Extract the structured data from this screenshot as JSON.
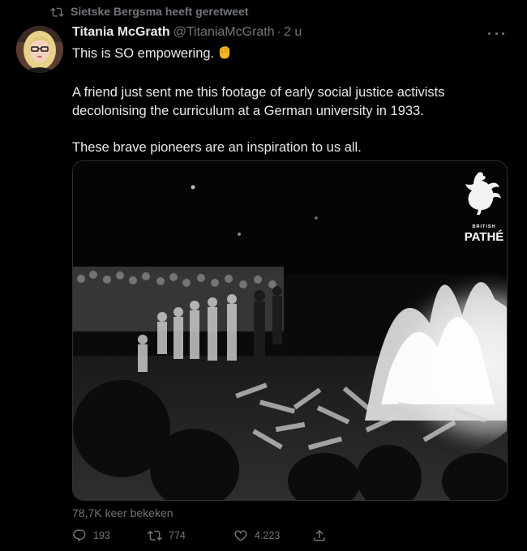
{
  "retweet": {
    "label": "Sietske Bergsma heeft geretweet"
  },
  "author": {
    "name": "Titania McGrath",
    "handle": "@TitaniaMcGrath",
    "separator": "·",
    "time": "2 u"
  },
  "tweet": {
    "line1": "This is SO empowering.",
    "line2": "A friend just sent me this footage of early social justice activists decolonising the curriculum at a German university in 1933.",
    "line3": "These brave pioneers are an inspiration to us all."
  },
  "media": {
    "watermark_small": "BRITISH",
    "watermark_brand": "PATHÉ"
  },
  "stats": {
    "views": "78,7K keer bekeken"
  },
  "actions": {
    "replies": "193",
    "retweets": "774",
    "likes": "4.223"
  },
  "icons": {
    "retweet_header": "retweet-icon",
    "more": "more-horizontal-icon",
    "fist": "raised-fist-emoji",
    "reply": "reply-icon",
    "retweet": "retweet-icon",
    "like": "heart-icon",
    "share": "share-icon",
    "rooster": "rooster-logo"
  },
  "colors": {
    "background": "#000000",
    "text": "#e7e9ea",
    "muted": "#71767b",
    "fist": "#f4b52a"
  }
}
